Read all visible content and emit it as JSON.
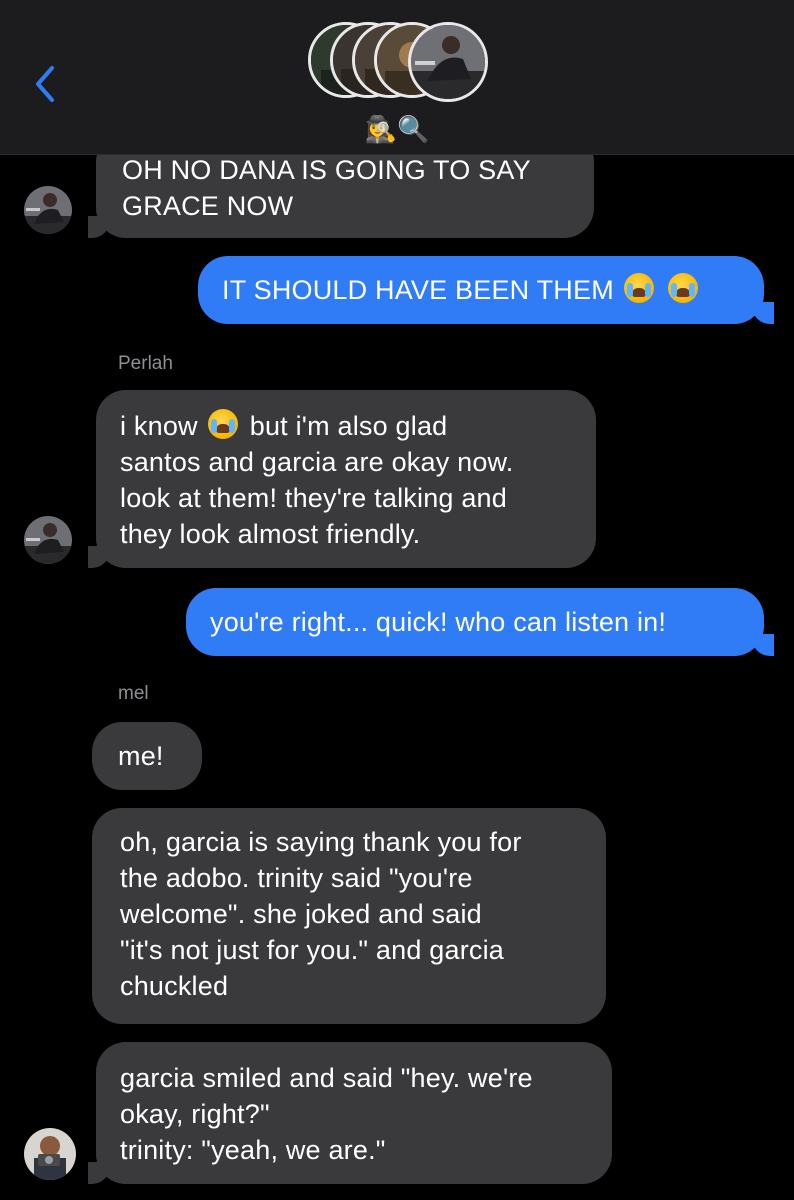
{
  "header": {
    "back_label": "<",
    "group_name": "🕵️‍♀️🔍",
    "accent": "#2f7cf6"
  },
  "messages": [
    {
      "lines": [
        "OH NO DANA IS GOING TO SAY",
        "GRACE NOW"
      ]
    },
    {
      "text": "IT SHOULD HAVE BEEN THEM"
    },
    {
      "sender": "Perlah",
      "first_prefix": "i know",
      "first_suffix": "but i'm also glad",
      "lines": [
        "santos and garcia are okay now.",
        "look at them! they're talking and",
        "they look almost friendly."
      ]
    },
    {
      "text": "you're right... quick! who can listen in!"
    },
    {
      "sender": "mel",
      "text": "me!"
    },
    {
      "lines": [
        "oh, garcia is saying thank you for",
        "the adobo. trinity said \"you're",
        "welcome\". she joked and said",
        "\"it's not just for you.\" and garcia",
        "chuckled"
      ]
    },
    {
      "lines": [
        "garcia smiled and said \"hey. we're",
        "okay, right?\"",
        "trinity: \"yeah, we are.\""
      ]
    }
  ],
  "colors": {
    "incoming_bubble": "#3a3a3c",
    "outgoing_bubble": "#2f7cf6",
    "sender_label": "#8e8e93",
    "header_bg": "#1c1c1e"
  }
}
